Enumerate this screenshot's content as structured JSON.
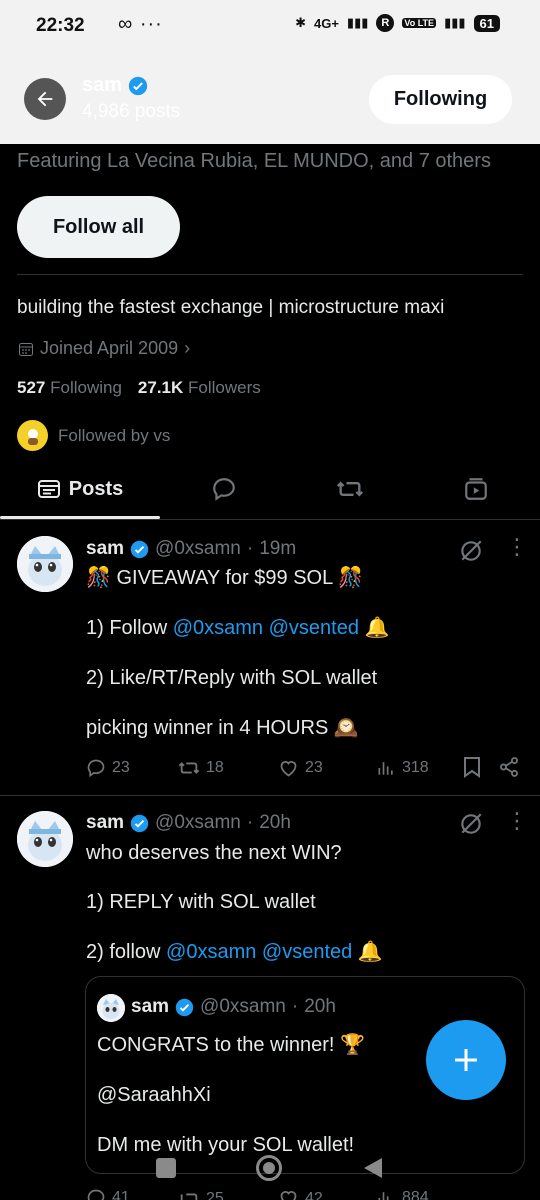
{
  "status_bar": {
    "time": "22:32",
    "icons_left": "∞ ···",
    "battery": "61",
    "network": "4G+",
    "volte": "Vo LTE"
  },
  "header": {
    "name": "sam",
    "posts": "4,986 posts",
    "following_label": "Following"
  },
  "profile": {
    "featuring": "Featuring La Vecina Rubia, EL MUNDO, and 7 others",
    "follow_all_label": "Follow all",
    "bio": "building the fastest exchange | microstructure maxi",
    "joined": "Joined April 2009",
    "following_count": "527",
    "following_label": "Following",
    "followers_count": "27.1K",
    "followers_label": "Followers",
    "followed_by": "Followed by vs"
  },
  "tabs": {
    "posts_label": "Posts"
  },
  "tweets": [
    {
      "name": "sam",
      "handle": "@0xsamn",
      "sep": "·",
      "time": "19m",
      "line1": "🎊 GIVEAWAY for $99 SOL 🎊",
      "line2_pre": "1) Follow ",
      "line2_link": "@0xsamn @vsented",
      "line2_post": " 🔔",
      "line3": "2) Like/RT/Reply with SOL wallet",
      "line4": "picking winner in 4 HOURS 🕰️",
      "replies": "23",
      "retweets": "18",
      "likes": "23",
      "views": "318"
    },
    {
      "name": "sam",
      "handle": "@0xsamn",
      "sep": "·",
      "time": "20h",
      "line1": "who deserves the next WIN?",
      "line2": "1) REPLY with SOL wallet",
      "line3_pre": "2) follow ",
      "line3_link": "@0xsamn @vsented",
      "line3_post": " 🔔",
      "quote": {
        "name": "sam",
        "handle": "@0xsamn",
        "sep": "·",
        "time": "20h",
        "line1": "CONGRATS to the winner! 🏆",
        "line2": "@SaraahhXi",
        "line3": "DM me with your SOL wallet!"
      },
      "replies": "41",
      "retweets": "25",
      "likes": "42",
      "views": "884"
    }
  ],
  "colors": {
    "accent": "#1d9bf0",
    "background": "#000000",
    "muted": "#71767b",
    "text": "#e7e9ea"
  }
}
